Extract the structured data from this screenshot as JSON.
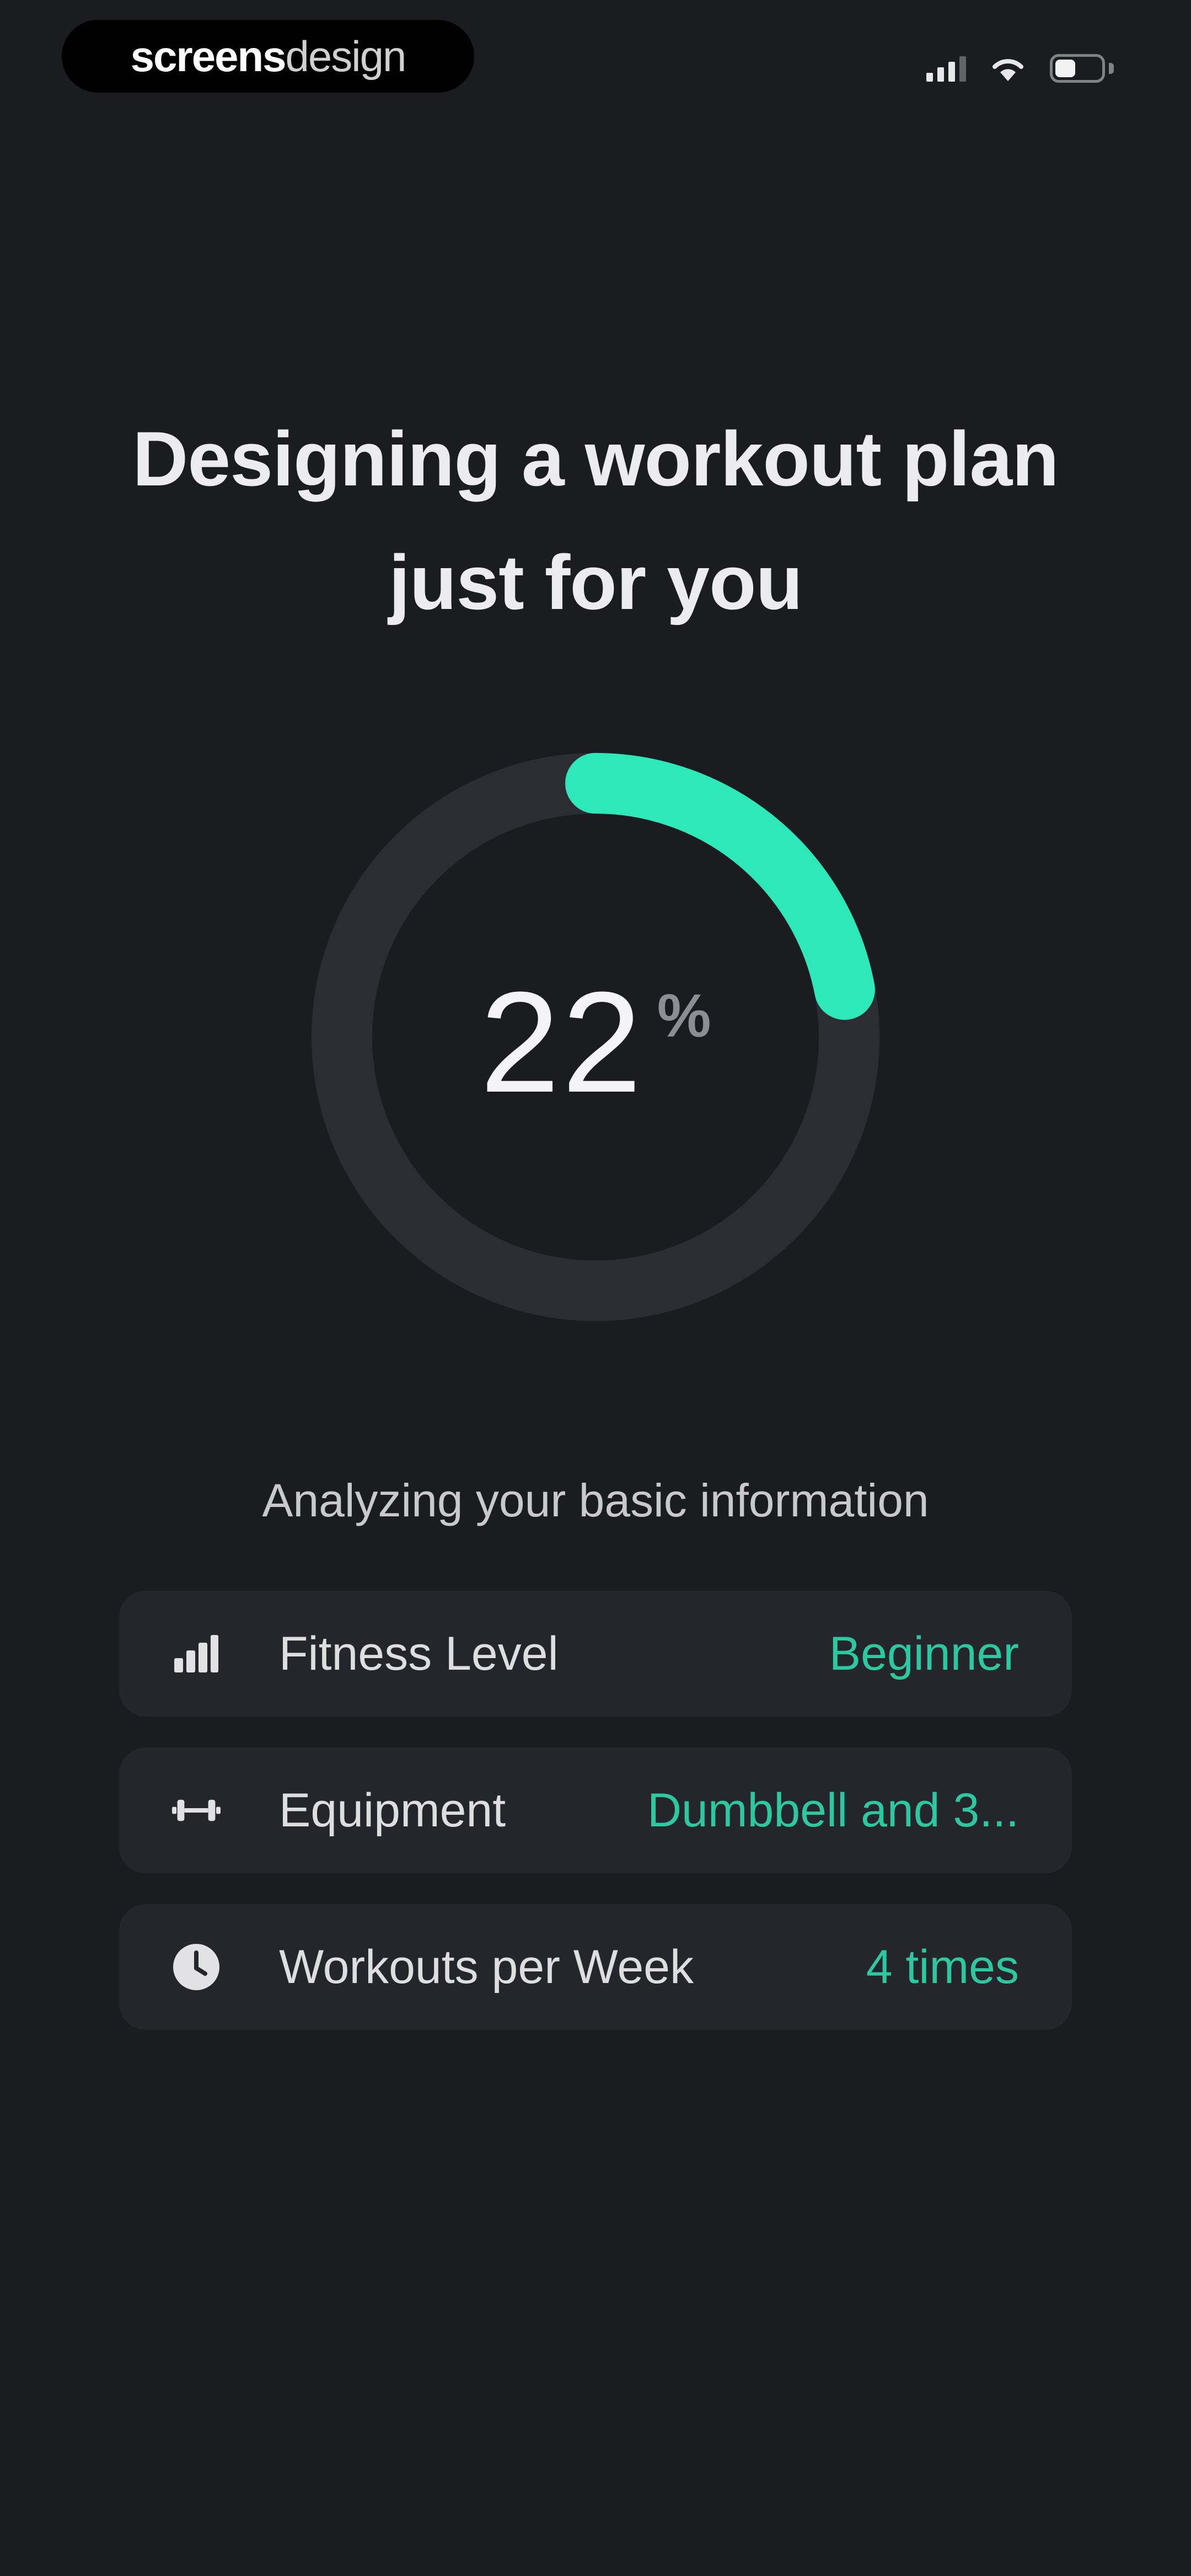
{
  "status_bar": {
    "brand_primary": "screens",
    "brand_secondary": "design",
    "icons": [
      "signal-icon",
      "wifi-icon",
      "battery-icon"
    ]
  },
  "header": {
    "title_line_1": "Designing a workout plan",
    "title_line_2": "just for you"
  },
  "progress": {
    "value": "22",
    "unit": "%",
    "fraction": 0.22
  },
  "caption": "Analyzing your basic information",
  "info_items": [
    {
      "icon": "bar-chart-icon",
      "label": "Fitness Level",
      "value": "Beginner"
    },
    {
      "icon": "dumbbell-icon",
      "label": "Equipment",
      "value": "Dumbbell and 3..."
    },
    {
      "icon": "clock-icon",
      "label": "Workouts per Week",
      "value": "4 times"
    }
  ],
  "colors": {
    "background": "#1b1c20",
    "card": "#25262b",
    "accent": "#2de8b8",
    "accent_text": "#2cc8a0",
    "ring_track": "#2c2d32"
  }
}
